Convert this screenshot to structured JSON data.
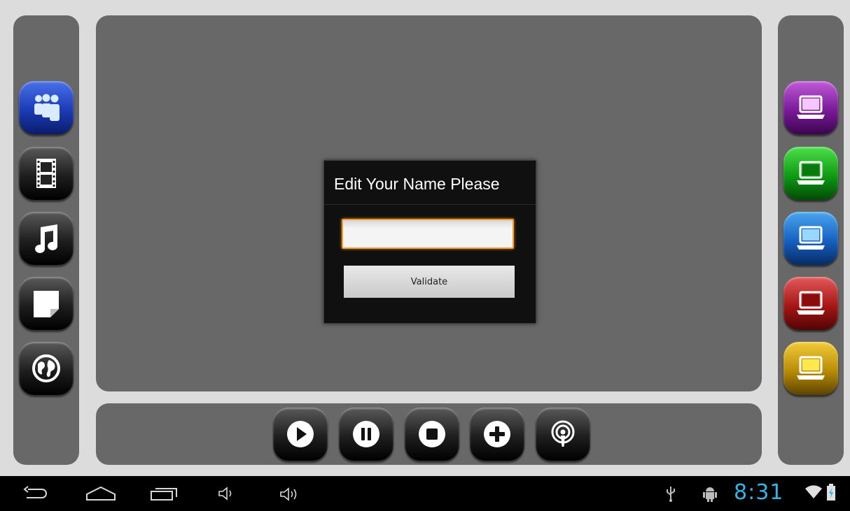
{
  "dialog": {
    "title": "Edit Your Name Please",
    "input_value": "",
    "validate_label": "Validate",
    "accent": "#f39a2c"
  },
  "left_sidebar": {
    "items": [
      {
        "name": "people",
        "icon": "people-icon",
        "color": "#1b3bb6"
      },
      {
        "name": "video",
        "icon": "film-icon",
        "color": "#1e1e1e"
      },
      {
        "name": "music",
        "icon": "music-note-icon",
        "color": "#1e1e1e"
      },
      {
        "name": "notes",
        "icon": "note-icon",
        "color": "#1e1e1e"
      },
      {
        "name": "web",
        "icon": "globe-icon",
        "color": "#1e1e1e"
      }
    ]
  },
  "right_sidebar": {
    "items": [
      {
        "name": "laptop-purple",
        "icon": "laptop-icon",
        "color": "#7a1a98"
      },
      {
        "name": "laptop-green",
        "icon": "laptop-icon",
        "color": "#0e9a14"
      },
      {
        "name": "laptop-blue",
        "icon": "laptop-icon",
        "color": "#1660c0"
      },
      {
        "name": "laptop-red",
        "icon": "laptop-icon",
        "color": "#a61616"
      },
      {
        "name": "laptop-yellow",
        "icon": "laptop-icon",
        "color": "#b98c06"
      }
    ]
  },
  "media_controls": {
    "items": [
      {
        "name": "play",
        "icon": "play-icon"
      },
      {
        "name": "pause",
        "icon": "pause-icon"
      },
      {
        "name": "stop",
        "icon": "stop-icon"
      },
      {
        "name": "add",
        "icon": "plus-icon"
      },
      {
        "name": "podcast",
        "icon": "podcast-icon"
      }
    ]
  },
  "system_bar": {
    "time": "8:31",
    "clock_color": "#33b5e5",
    "icons": [
      "back-icon",
      "home-icon",
      "recent-apps-icon",
      "volume-down-icon",
      "volume-up-icon",
      "usb-icon",
      "android-debug-icon",
      "wifi-icon",
      "battery-icon"
    ]
  }
}
